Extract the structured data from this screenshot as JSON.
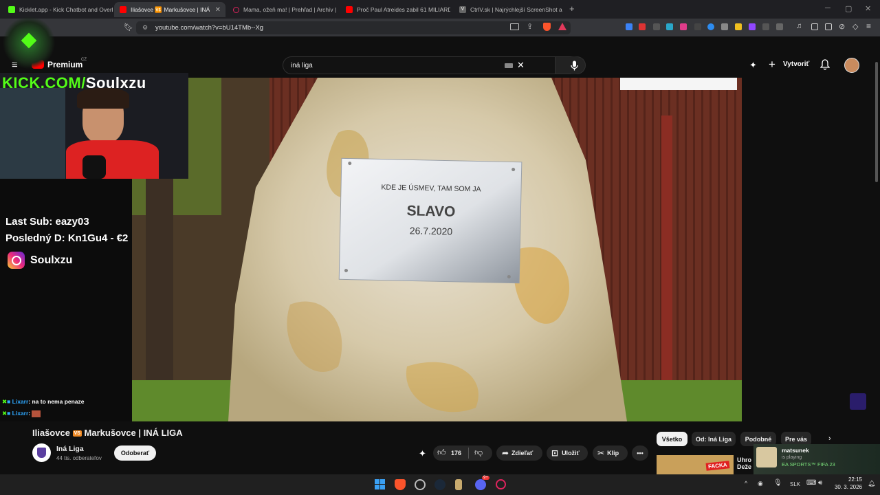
{
  "tabs": [
    {
      "label": "Kicklet.app - Kick Chatbot and Overla",
      "color": "#53fc18"
    },
    {
      "label": "Iliašovce 🆚 Markušovce | INÁ LIGA",
      "color": "#ff0000"
    },
    {
      "label": "Mama, ožeň ma! | Prehľad | Archív | T",
      "color": "#e0245e"
    },
    {
      "label": "Proč Paul Atreides zabil 61 MILIARD l",
      "color": "#ff0000"
    },
    {
      "label": "CtrlV.sk | Najrýchlejší ScreenShot a P",
      "color": "#cccccc"
    }
  ],
  "browser": {
    "url": "youtube.com/watch?v=bU14TMb--Xg",
    "new_tab": "+"
  },
  "youtube": {
    "brand": "Premium",
    "country": "CZ",
    "search_query": "iná liga",
    "create_label": "Vytvoriť"
  },
  "overlay": {
    "kick_prefix": "KICK.COM/",
    "kick_user": "Soulxzu",
    "last_sub": "Last Sub: eazy03",
    "last_donation": "Posledný D: Kn1Gu4 - €2",
    "instagram": "Soulxzu",
    "chat": [
      {
        "user": "Lixarr",
        "text": ": na to nema penaze"
      },
      {
        "user": "Lixarr",
        "text": ":"
      }
    ]
  },
  "video": {
    "plaque_line1": "KDE JE ÚSMEV, TAM SOM JA",
    "plaque_name": "SLAVO",
    "plaque_date": "26.7.2020"
  },
  "meta": {
    "title_a": "Iliašovce",
    "vs": "VS",
    "title_b": "Markušovce",
    "title_sep": "|",
    "title_c": "INÁ LIGA",
    "channel": "Iná Liga",
    "subscribers": "44 tis. odberateľov",
    "subscribe_label": "Odoberať",
    "likes": "176",
    "share_label": "Zdieľať",
    "save_label": "Uložiť",
    "clip_label": "Klip",
    "chips": [
      "Všetko",
      "Od: Iná Liga",
      "Podobné",
      "Pre vás"
    ],
    "rec_title_1": "Uhro",
    "rec_title_2": "Deže",
    "rec_thumb_text": "FACKA"
  },
  "discord": {
    "user": "matsunek",
    "status": "is playing",
    "game": "EA SPORTS™ FIFA 23"
  },
  "taskbar": {
    "lang": "SLK",
    "time": "22:15",
    "date": "30. 3. 2026",
    "badge": "9+"
  },
  "colors": {
    "accent": "#ff0000",
    "kick": "#53fc18",
    "yt_bg": "#0f0f0f"
  }
}
